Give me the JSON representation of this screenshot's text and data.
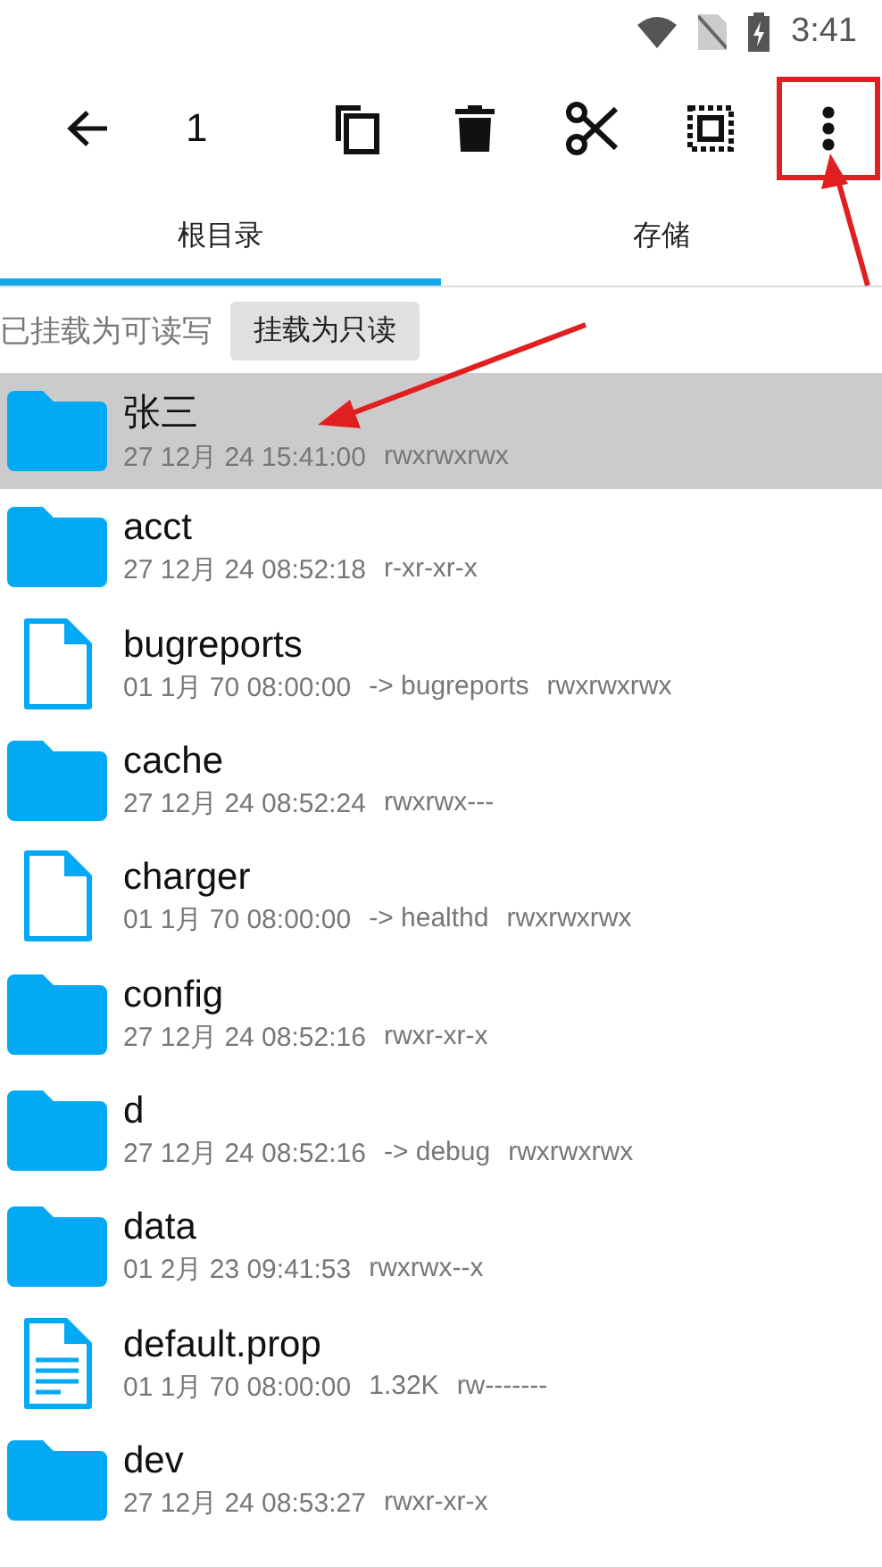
{
  "status_bar": {
    "time": "3:41"
  },
  "toolbar": {
    "count": "1",
    "actions": [
      {
        "kind": "copy",
        "highlighted": false
      },
      {
        "kind": "delete",
        "highlighted": false
      },
      {
        "kind": "cut",
        "highlighted": false
      },
      {
        "kind": "select",
        "highlighted": false
      },
      {
        "kind": "more",
        "highlighted": true
      }
    ]
  },
  "tabs": [
    {
      "label": "根目录",
      "selected": true
    },
    {
      "label": "存储",
      "selected": false
    }
  ],
  "mount": {
    "status": "已挂载为可读写",
    "button": "挂载为只读"
  },
  "files": [
    {
      "kind": "folder",
      "name": "张三",
      "meta": [
        "27 12月 24 15:41:00",
        "rwxrwxrwx"
      ],
      "selected": true
    },
    {
      "kind": "folder",
      "name": "acct",
      "meta": [
        "27 12月 24 08:52:18",
        "r-xr-xr-x"
      ],
      "selected": false
    },
    {
      "kind": "file",
      "name": "bugreports",
      "meta": [
        "01 1月 70 08:00:00",
        "-> bugreports",
        "rwxrwxrwx"
      ],
      "selected": false
    },
    {
      "kind": "folder",
      "name": "cache",
      "meta": [
        "27 12月 24 08:52:24",
        "rwxrwx---"
      ],
      "selected": false
    },
    {
      "kind": "file",
      "name": "charger",
      "meta": [
        "01 1月 70 08:00:00",
        "-> healthd",
        "rwxrwxrwx"
      ],
      "selected": false
    },
    {
      "kind": "folder",
      "name": "config",
      "meta": [
        "27 12月 24 08:52:16",
        "rwxr-xr-x"
      ],
      "selected": false
    },
    {
      "kind": "folder",
      "name": "d",
      "meta": [
        "27 12月 24 08:52:16",
        "-> debug",
        "rwxrwxrwx"
      ],
      "selected": false
    },
    {
      "kind": "folder",
      "name": "data",
      "meta": [
        "01 2月 23 09:41:53",
        "rwxrwx--x"
      ],
      "selected": false
    },
    {
      "kind": "text",
      "name": "default.prop",
      "meta": [
        "01 1月 70 08:00:00",
        "1.32K",
        "rw-------"
      ],
      "selected": false
    },
    {
      "kind": "folder",
      "name": "dev",
      "meta": [
        "27 12月 24 08:53:27",
        "rwxr-xr-x"
      ],
      "selected": false
    }
  ]
}
